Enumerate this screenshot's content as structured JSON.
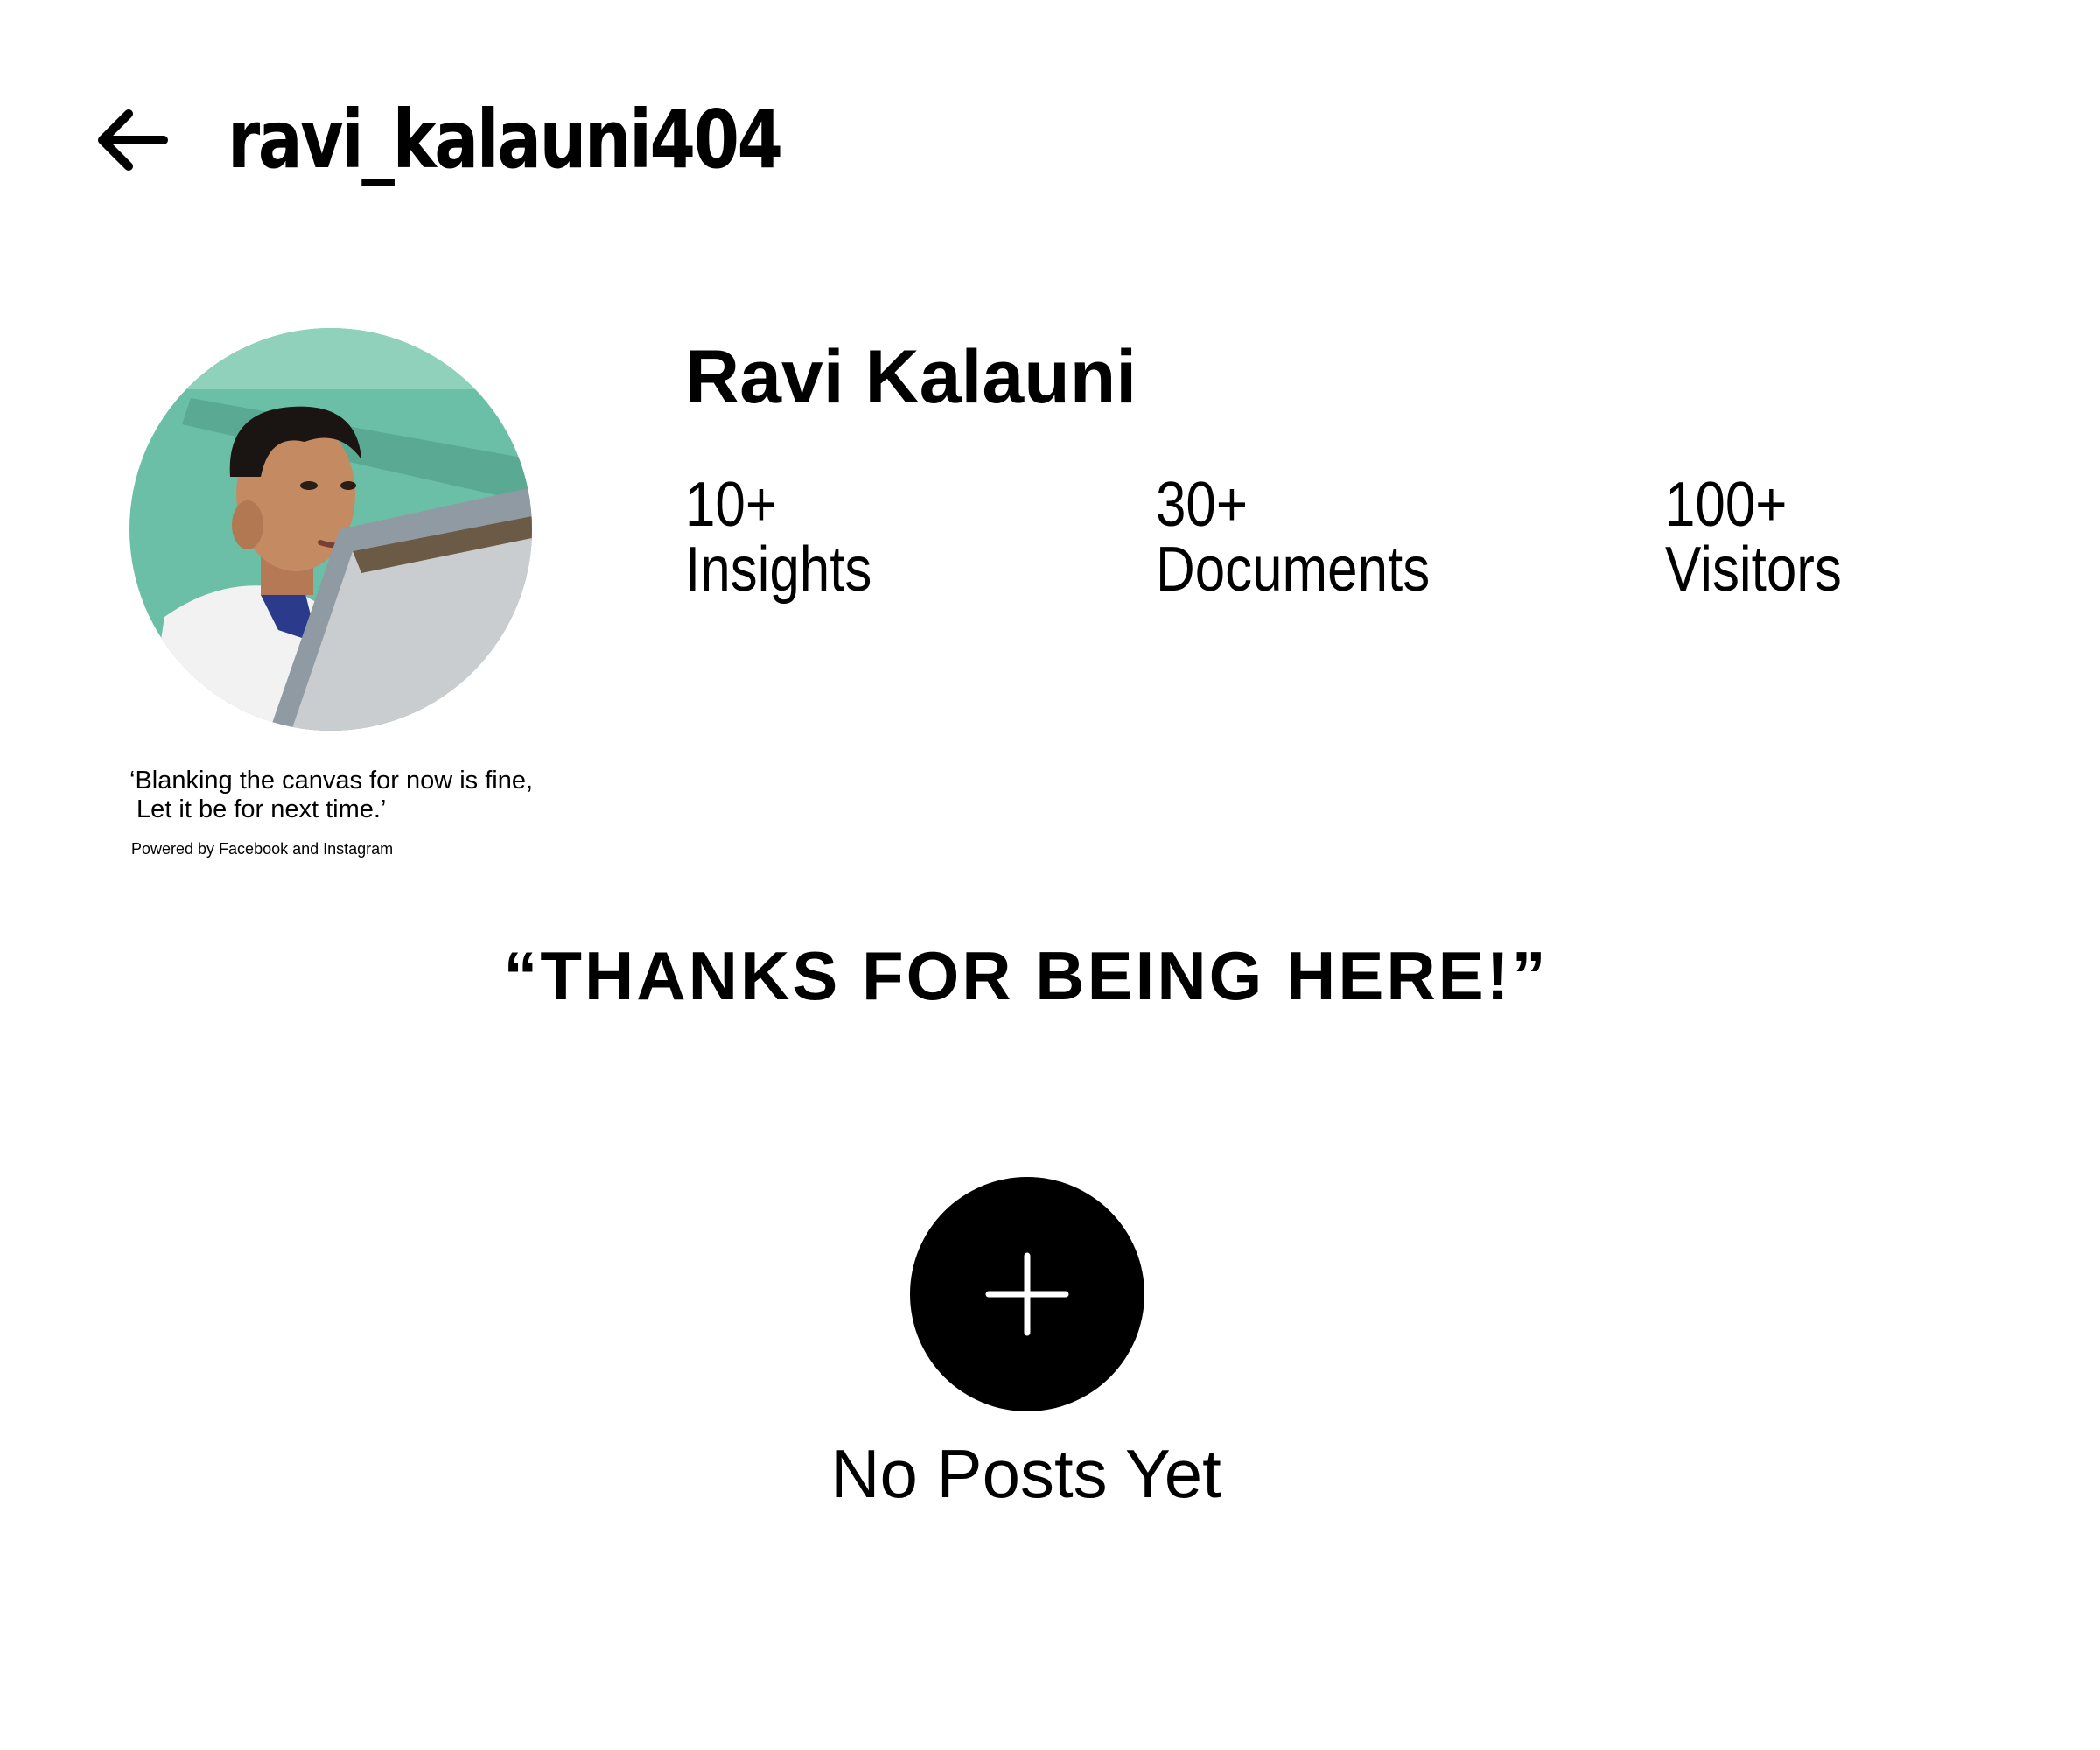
{
  "header": {
    "back_icon": "arrow-left-icon",
    "username": "ravi_kalauni404"
  },
  "profile": {
    "display_name": "Ravi Kalauni",
    "avatar_alt": "Profile photo",
    "bio": "‘Blanking the canvas for now is fine,\n Let it be for next time.’",
    "powered_by": "Powered by Facebook and Instagram",
    "stats": [
      {
        "value": "10+",
        "label": "Insights"
      },
      {
        "value": "30+",
        "label": "Documents"
      },
      {
        "value": "100+",
        "label": "Visitors"
      }
    ]
  },
  "tagline": "“THANKS FOR BEING HERE!”",
  "posts": {
    "add_icon": "plus-icon",
    "empty_text": "No Posts Yet"
  },
  "colors": {
    "text": "#000000",
    "background": "#ffffff",
    "avatar_backdrop": "#6bbfa6"
  }
}
